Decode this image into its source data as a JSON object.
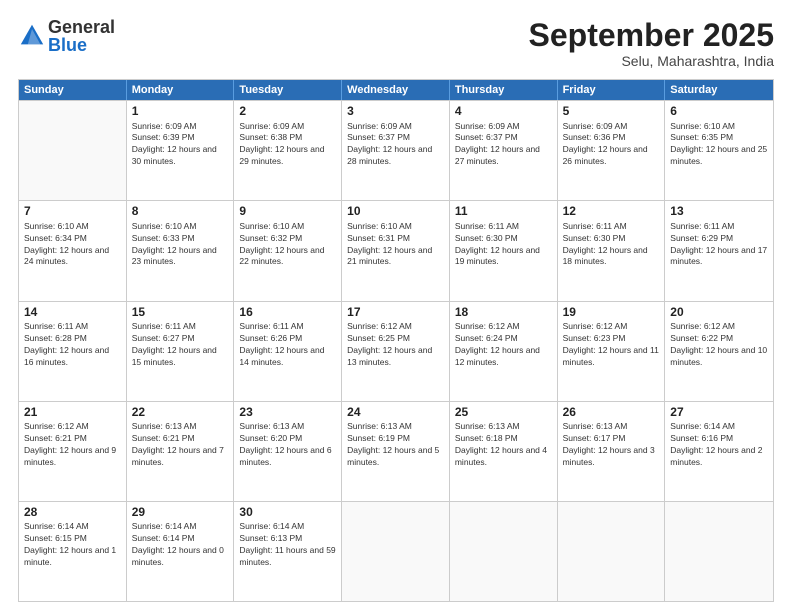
{
  "logo": {
    "general": "General",
    "blue": "Blue"
  },
  "title": "September 2025",
  "location": "Selu, Maharashtra, India",
  "days_of_week": [
    "Sunday",
    "Monday",
    "Tuesday",
    "Wednesday",
    "Thursday",
    "Friday",
    "Saturday"
  ],
  "weeks": [
    [
      {
        "day": "",
        "empty": true
      },
      {
        "day": "1",
        "sunrise": "6:09 AM",
        "sunset": "6:39 PM",
        "daylight": "12 hours and 30 minutes."
      },
      {
        "day": "2",
        "sunrise": "6:09 AM",
        "sunset": "6:38 PM",
        "daylight": "12 hours and 29 minutes."
      },
      {
        "day": "3",
        "sunrise": "6:09 AM",
        "sunset": "6:37 PM",
        "daylight": "12 hours and 28 minutes."
      },
      {
        "day": "4",
        "sunrise": "6:09 AM",
        "sunset": "6:37 PM",
        "daylight": "12 hours and 27 minutes."
      },
      {
        "day": "5",
        "sunrise": "6:09 AM",
        "sunset": "6:36 PM",
        "daylight": "12 hours and 26 minutes."
      },
      {
        "day": "6",
        "sunrise": "6:10 AM",
        "sunset": "6:35 PM",
        "daylight": "12 hours and 25 minutes."
      }
    ],
    [
      {
        "day": "7",
        "sunrise": "6:10 AM",
        "sunset": "6:34 PM",
        "daylight": "12 hours and 24 minutes."
      },
      {
        "day": "8",
        "sunrise": "6:10 AM",
        "sunset": "6:33 PM",
        "daylight": "12 hours and 23 minutes."
      },
      {
        "day": "9",
        "sunrise": "6:10 AM",
        "sunset": "6:32 PM",
        "daylight": "12 hours and 22 minutes."
      },
      {
        "day": "10",
        "sunrise": "6:10 AM",
        "sunset": "6:31 PM",
        "daylight": "12 hours and 21 minutes."
      },
      {
        "day": "11",
        "sunrise": "6:11 AM",
        "sunset": "6:30 PM",
        "daylight": "12 hours and 19 minutes."
      },
      {
        "day": "12",
        "sunrise": "6:11 AM",
        "sunset": "6:30 PM",
        "daylight": "12 hours and 18 minutes."
      },
      {
        "day": "13",
        "sunrise": "6:11 AM",
        "sunset": "6:29 PM",
        "daylight": "12 hours and 17 minutes."
      }
    ],
    [
      {
        "day": "14",
        "sunrise": "6:11 AM",
        "sunset": "6:28 PM",
        "daylight": "12 hours and 16 minutes."
      },
      {
        "day": "15",
        "sunrise": "6:11 AM",
        "sunset": "6:27 PM",
        "daylight": "12 hours and 15 minutes."
      },
      {
        "day": "16",
        "sunrise": "6:11 AM",
        "sunset": "6:26 PM",
        "daylight": "12 hours and 14 minutes."
      },
      {
        "day": "17",
        "sunrise": "6:12 AM",
        "sunset": "6:25 PM",
        "daylight": "12 hours and 13 minutes."
      },
      {
        "day": "18",
        "sunrise": "6:12 AM",
        "sunset": "6:24 PM",
        "daylight": "12 hours and 12 minutes."
      },
      {
        "day": "19",
        "sunrise": "6:12 AM",
        "sunset": "6:23 PM",
        "daylight": "12 hours and 11 minutes."
      },
      {
        "day": "20",
        "sunrise": "6:12 AM",
        "sunset": "6:22 PM",
        "daylight": "12 hours and 10 minutes."
      }
    ],
    [
      {
        "day": "21",
        "sunrise": "6:12 AM",
        "sunset": "6:21 PM",
        "daylight": "12 hours and 9 minutes."
      },
      {
        "day": "22",
        "sunrise": "6:13 AM",
        "sunset": "6:21 PM",
        "daylight": "12 hours and 7 minutes."
      },
      {
        "day": "23",
        "sunrise": "6:13 AM",
        "sunset": "6:20 PM",
        "daylight": "12 hours and 6 minutes."
      },
      {
        "day": "24",
        "sunrise": "6:13 AM",
        "sunset": "6:19 PM",
        "daylight": "12 hours and 5 minutes."
      },
      {
        "day": "25",
        "sunrise": "6:13 AM",
        "sunset": "6:18 PM",
        "daylight": "12 hours and 4 minutes."
      },
      {
        "day": "26",
        "sunrise": "6:13 AM",
        "sunset": "6:17 PM",
        "daylight": "12 hours and 3 minutes."
      },
      {
        "day": "27",
        "sunrise": "6:14 AM",
        "sunset": "6:16 PM",
        "daylight": "12 hours and 2 minutes."
      }
    ],
    [
      {
        "day": "28",
        "sunrise": "6:14 AM",
        "sunset": "6:15 PM",
        "daylight": "12 hours and 1 minute."
      },
      {
        "day": "29",
        "sunrise": "6:14 AM",
        "sunset": "6:14 PM",
        "daylight": "12 hours and 0 minutes."
      },
      {
        "day": "30",
        "sunrise": "6:14 AM",
        "sunset": "6:13 PM",
        "daylight": "11 hours and 59 minutes."
      },
      {
        "day": "",
        "empty": true
      },
      {
        "day": "",
        "empty": true
      },
      {
        "day": "",
        "empty": true
      },
      {
        "day": "",
        "empty": true
      }
    ]
  ]
}
